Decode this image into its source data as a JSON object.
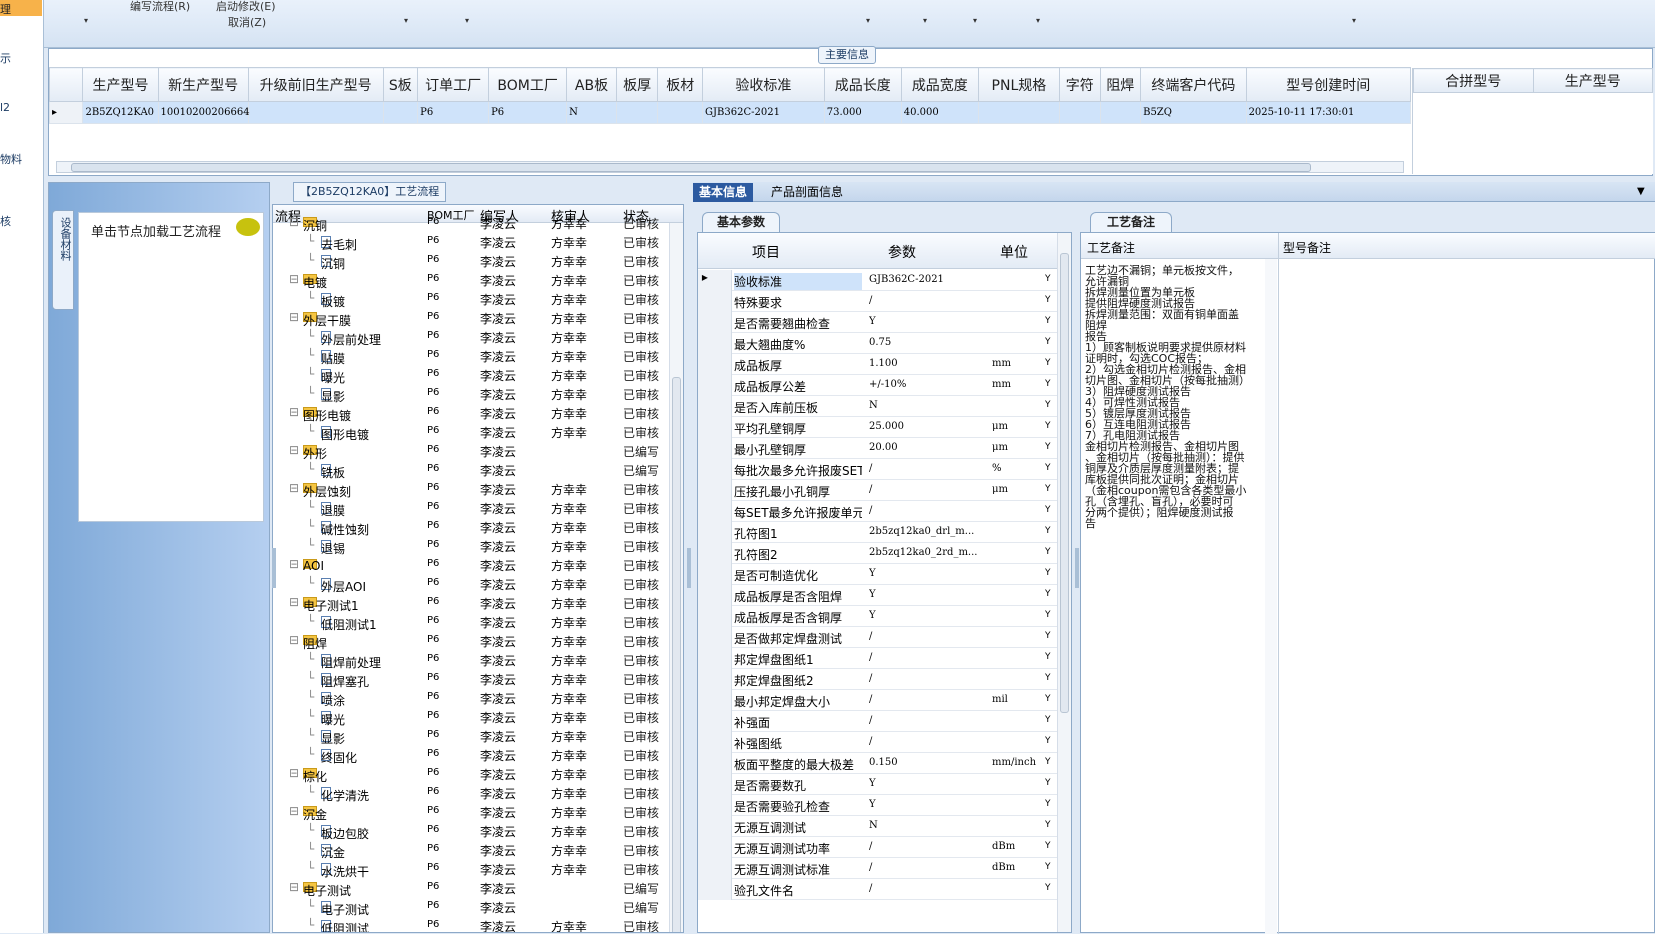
{
  "left_nav": {
    "items": [
      "理",
      "示",
      "l2",
      "物料",
      "核"
    ]
  },
  "toolbar": {
    "edit_flow": "编写流程(R)",
    "start_modify": "启动修改(E)",
    "cancel": "取消(Z)",
    "dropdown_glyph": "▾"
  },
  "main_info": {
    "title": "主要信息",
    "columns": [
      "生产型号",
      "新生产型号",
      "升级前旧生产型号",
      "S板",
      "订单工厂",
      "BOM工厂",
      "AB板",
      "板厚",
      "板材",
      "验收标准",
      "成品长度",
      "成品宽度",
      "PNL规格",
      "字符",
      "阻焊",
      "终端客户代码",
      "型号创建时间"
    ],
    "row": [
      "2B5ZQ12KA0",
      "10010200206664",
      "",
      "",
      "P6",
      "P6",
      "N",
      "",
      "",
      "GJB362C-2021",
      "73.000",
      "40.000",
      "",
      "",
      "",
      "B5ZQ",
      "2025-10-11 17:30:01"
    ],
    "merge_columns": [
      "合拼型号",
      "生产型号"
    ]
  },
  "process": {
    "title": "【2B5ZQ12KA0】工艺流程",
    "side_tab": "设备材料",
    "load_hint": "单击节点加载工艺流程",
    "columns": [
      "流程",
      "BOM工厂",
      "编写人",
      "核审人",
      "状态"
    ],
    "rows": [
      {
        "level": 1,
        "name": "沉铜",
        "bom": "P6",
        "writer": "李凌云",
        "checker": "方幸幸",
        "status": "已审核",
        "partial": true
      },
      {
        "level": 2,
        "name": "去毛刺",
        "bom": "P6",
        "writer": "李凌云",
        "checker": "方幸幸",
        "status": "已审核"
      },
      {
        "level": 2,
        "name": "沉铜",
        "bom": "P6",
        "writer": "李凌云",
        "checker": "方幸幸",
        "status": "已审核"
      },
      {
        "level": 1,
        "name": "电镀",
        "bom": "P6",
        "writer": "李凌云",
        "checker": "方幸幸",
        "status": "已审核"
      },
      {
        "level": 2,
        "name": "板镀",
        "bom": "P6",
        "writer": "李凌云",
        "checker": "方幸幸",
        "status": "已审核"
      },
      {
        "level": 1,
        "name": "外层干膜",
        "bom": "P6",
        "writer": "李凌云",
        "checker": "方幸幸",
        "status": "已审核"
      },
      {
        "level": 2,
        "name": "外层前处理",
        "bom": "P6",
        "writer": "李凌云",
        "checker": "方幸幸",
        "status": "已审核"
      },
      {
        "level": 2,
        "name": "贴膜",
        "bom": "P6",
        "writer": "李凌云",
        "checker": "方幸幸",
        "status": "已审核"
      },
      {
        "level": 2,
        "name": "曝光",
        "bom": "P6",
        "writer": "李凌云",
        "checker": "方幸幸",
        "status": "已审核"
      },
      {
        "level": 2,
        "name": "显影",
        "bom": "P6",
        "writer": "李凌云",
        "checker": "方幸幸",
        "status": "已审核"
      },
      {
        "level": 1,
        "name": "图形电镀",
        "bom": "P6",
        "writer": "李凌云",
        "checker": "方幸幸",
        "status": "已审核"
      },
      {
        "level": 2,
        "name": "图形电镀",
        "bom": "P6",
        "writer": "李凌云",
        "checker": "方幸幸",
        "status": "已审核"
      },
      {
        "level": 1,
        "name": "外形",
        "bom": "P6",
        "writer": "李凌云",
        "checker": "",
        "status": "已编写"
      },
      {
        "level": 2,
        "name": "铣板",
        "bom": "P6",
        "writer": "李凌云",
        "checker": "",
        "status": "已编写"
      },
      {
        "level": 1,
        "name": "外层蚀刻",
        "bom": "P6",
        "writer": "李凌云",
        "checker": "方幸幸",
        "status": "已审核"
      },
      {
        "level": 2,
        "name": "退膜",
        "bom": "P6",
        "writer": "李凌云",
        "checker": "方幸幸",
        "status": "已审核"
      },
      {
        "level": 2,
        "name": "碱性蚀刻",
        "bom": "P6",
        "writer": "李凌云",
        "checker": "方幸幸",
        "status": "已审核"
      },
      {
        "level": 2,
        "name": "退锡",
        "bom": "P6",
        "writer": "李凌云",
        "checker": "方幸幸",
        "status": "已审核"
      },
      {
        "level": 1,
        "name": "AOI",
        "bom": "P6",
        "writer": "李凌云",
        "checker": "方幸幸",
        "status": "已审核"
      },
      {
        "level": 2,
        "name": "外层AOI",
        "bom": "P6",
        "writer": "李凌云",
        "checker": "方幸幸",
        "status": "已审核"
      },
      {
        "level": 1,
        "name": "电子测试1",
        "bom": "P6",
        "writer": "李凌云",
        "checker": "方幸幸",
        "status": "已审核"
      },
      {
        "level": 2,
        "name": "低阻测试1",
        "bom": "P6",
        "writer": "李凌云",
        "checker": "方幸幸",
        "status": "已审核"
      },
      {
        "level": 1,
        "name": "阻焊",
        "bom": "P6",
        "writer": "李凌云",
        "checker": "方幸幸",
        "status": "已审核"
      },
      {
        "level": 2,
        "name": "阻焊前处理",
        "bom": "P6",
        "writer": "李凌云",
        "checker": "方幸幸",
        "status": "已审核"
      },
      {
        "level": 2,
        "name": "阻焊塞孔",
        "bom": "P6",
        "writer": "李凌云",
        "checker": "方幸幸",
        "status": "已审核"
      },
      {
        "level": 2,
        "name": "喷涂",
        "bom": "P6",
        "writer": "李凌云",
        "checker": "方幸幸",
        "status": "已审核"
      },
      {
        "level": 2,
        "name": "曝光",
        "bom": "P6",
        "writer": "李凌云",
        "checker": "方幸幸",
        "status": "已审核"
      },
      {
        "level": 2,
        "name": "显影",
        "bom": "P6",
        "writer": "李凌云",
        "checker": "方幸幸",
        "status": "已审核"
      },
      {
        "level": 2,
        "name": "终固化",
        "bom": "P6",
        "writer": "李凌云",
        "checker": "方幸幸",
        "status": "已审核"
      },
      {
        "level": 1,
        "name": "棕化",
        "bom": "P6",
        "writer": "李凌云",
        "checker": "方幸幸",
        "status": "已审核"
      },
      {
        "level": 2,
        "name": "化学清洗",
        "bom": "P6",
        "writer": "李凌云",
        "checker": "方幸幸",
        "status": "已审核"
      },
      {
        "level": 1,
        "name": "沉金",
        "bom": "P6",
        "writer": "李凌云",
        "checker": "方幸幸",
        "status": "已审核"
      },
      {
        "level": 2,
        "name": "板边包胶",
        "bom": "P6",
        "writer": "李凌云",
        "checker": "方幸幸",
        "status": "已审核"
      },
      {
        "level": 2,
        "name": "沉金",
        "bom": "P6",
        "writer": "李凌云",
        "checker": "方幸幸",
        "status": "已审核"
      },
      {
        "level": 2,
        "name": "水洗烘干",
        "bom": "P6",
        "writer": "李凌云",
        "checker": "方幸幸",
        "status": "已审核"
      },
      {
        "level": 1,
        "name": "电子测试",
        "bom": "P6",
        "writer": "李凌云",
        "checker": "",
        "status": "已编写"
      },
      {
        "level": 2,
        "name": "电子测试",
        "bom": "P6",
        "writer": "李凌云",
        "checker": "",
        "status": "已编写"
      },
      {
        "level": 2,
        "name": "低阻测试",
        "bom": "P6",
        "writer": "李凌云",
        "checker": "方幸幸",
        "status": "已审核"
      }
    ]
  },
  "detail_tabs": [
    "基本信息",
    "产品剖面信息"
  ],
  "basic_params": {
    "tab": "基本参数",
    "columns": [
      "项目",
      "参数",
      "单位"
    ],
    "rows": [
      {
        "item": "验收标准",
        "value": "GJB362C-2021",
        "unit": "",
        "flag": "Y"
      },
      {
        "item": "特殊要求",
        "value": "/",
        "unit": "",
        "flag": "Y"
      },
      {
        "item": "是否需要翘曲检查",
        "value": "Y",
        "unit": "",
        "flag": "Y"
      },
      {
        "item": "最大翘曲度%",
        "value": "0.75",
        "unit": "",
        "flag": "Y"
      },
      {
        "item": "成品板厚",
        "value": "1.100",
        "unit": "mm",
        "flag": "Y"
      },
      {
        "item": "成品板厚公差",
        "value": "+/-10%",
        "unit": "mm",
        "flag": "Y"
      },
      {
        "item": "是否入库前压板",
        "value": "N",
        "unit": "",
        "flag": "Y"
      },
      {
        "item": "平均孔壁铜厚",
        "value": "25.000",
        "unit": "μm",
        "flag": "Y"
      },
      {
        "item": "最小孔壁铜厚",
        "value": "20.00",
        "unit": "μm",
        "flag": "Y"
      },
      {
        "item": "每批次最多允许报废SET",
        "value": "/",
        "unit": "%",
        "flag": "Y"
      },
      {
        "item": "压接孔最小孔铜厚",
        "value": "/",
        "unit": "μm",
        "flag": "Y"
      },
      {
        "item": "每SET最多允许报废单元",
        "value": "/",
        "unit": "",
        "flag": "Y"
      },
      {
        "item": "孔符图1",
        "value": "2b5zq12ka0_drl_m...",
        "unit": "",
        "flag": "Y"
      },
      {
        "item": "孔符图2",
        "value": "2b5zq12ka0_2rd_m...",
        "unit": "",
        "flag": "Y"
      },
      {
        "item": "是否可制造优化",
        "value": "Y",
        "unit": "",
        "flag": "Y"
      },
      {
        "item": "成品板厚是否含阻焊",
        "value": "Y",
        "unit": "",
        "flag": "Y"
      },
      {
        "item": "成品板厚是否含铜厚",
        "value": "Y",
        "unit": "",
        "flag": "Y"
      },
      {
        "item": "是否做邦定焊盘测试",
        "value": "/",
        "unit": "",
        "flag": "Y"
      },
      {
        "item": "邦定焊盘图纸1",
        "value": "/",
        "unit": "",
        "flag": "Y"
      },
      {
        "item": "邦定焊盘图纸2",
        "value": "/",
        "unit": "",
        "flag": "Y"
      },
      {
        "item": "最小邦定焊盘大小",
        "value": "/",
        "unit": "mil",
        "flag": "Y"
      },
      {
        "item": "补强面",
        "value": "/",
        "unit": "",
        "flag": "Y"
      },
      {
        "item": "补强图纸",
        "value": "/",
        "unit": "",
        "flag": "Y"
      },
      {
        "item": "板面平整度的最大极差",
        "value": "0.150",
        "unit": "mm/inch",
        "flag": "Y"
      },
      {
        "item": "是否需要数孔",
        "value": "Y",
        "unit": "",
        "flag": "Y"
      },
      {
        "item": "是否需要验孔检查",
        "value": "Y",
        "unit": "",
        "flag": "Y"
      },
      {
        "item": "无源互调测试",
        "value": "N",
        "unit": "",
        "flag": "Y"
      },
      {
        "item": "无源互调测试功率",
        "value": "/",
        "unit": "dBm",
        "flag": "Y"
      },
      {
        "item": "无源互调测试标准",
        "value": "/",
        "unit": "dBm",
        "flag": "Y"
      },
      {
        "item": "验孔文件名",
        "value": "/",
        "unit": "",
        "flag": "Y"
      }
    ]
  },
  "process_notes": {
    "tab": "工艺备注",
    "columns": [
      "工艺备注",
      "型号备注"
    ],
    "text_lines": [
      "工艺边不漏铜；单元板按文件，",
      "允许漏铜",
      "拆焊测量位置为单元板",
      "提供阻焊硬度测试报告",
      "拆焊测量范围：双面有铜单面盖",
      "阻焊",
      "报告",
      "1）顾客制板说明要求提供原材料",
      "证明时，勾选COC报告；",
      "2）勾选金相切片检测报告、金相",
      "切片图、金相切片（按每批抽测）",
      "3）阻焊硬度测试报告",
      "4）可焊性测试报告",
      "5）镀层厚度测试报告",
      "6）互连电阻测试报告",
      "7）孔电阻测试报告",
      "金相切片检测报告、金相切片图",
      "、金相切片（按每批抽测）：提供",
      "铜厚及介质层厚度测量附表；提",
      "库板提供同批次证明；金相切片",
      "（金相coupon需包含各类型最小",
      "孔（含埋孔、盲孔），必要时可",
      "分两个提供）；阻焊硬度测试报",
      "告"
    ]
  }
}
